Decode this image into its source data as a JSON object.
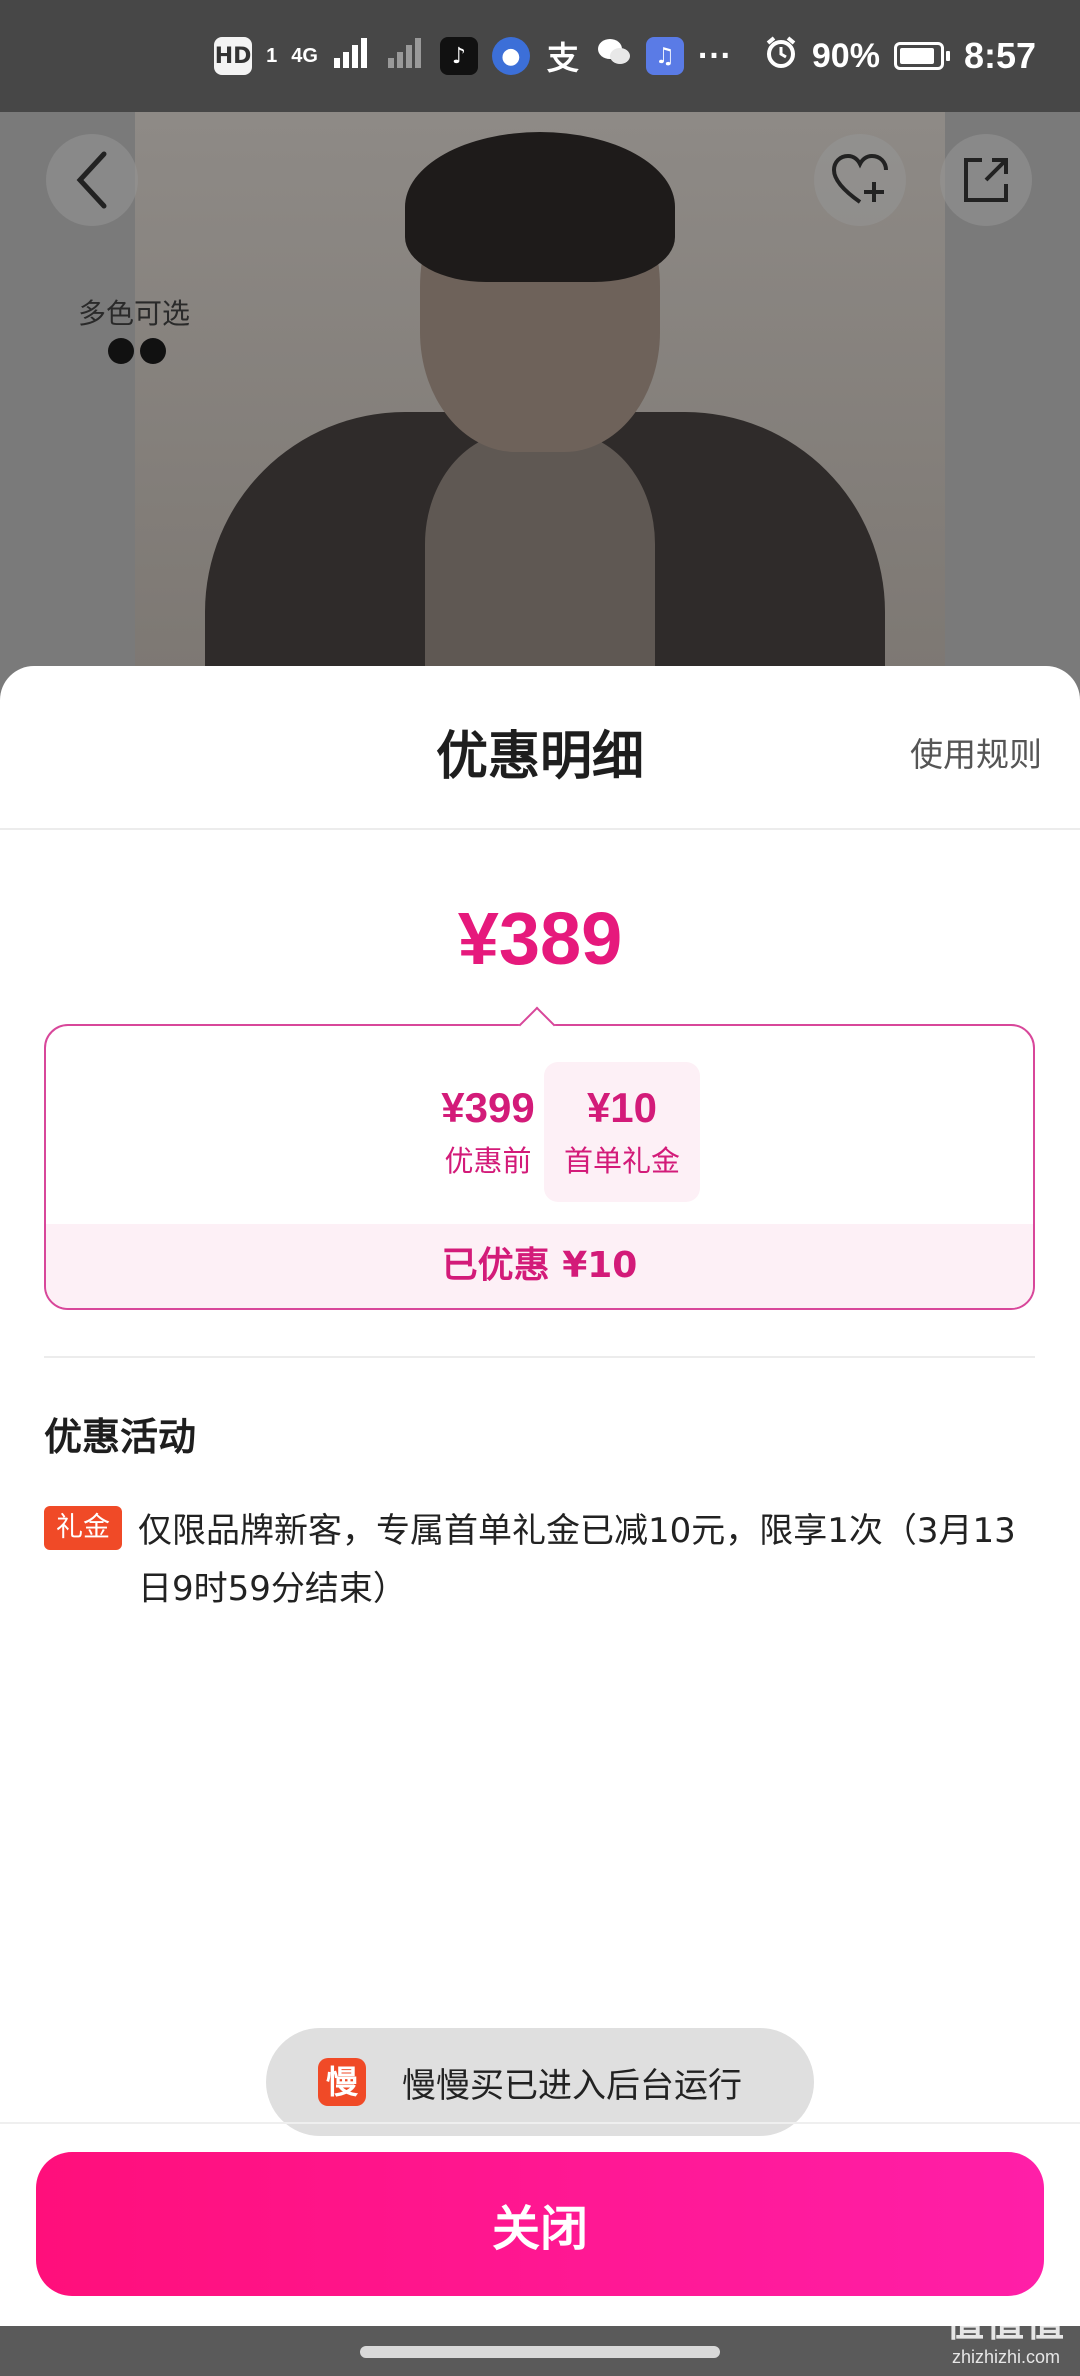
{
  "status_bar": {
    "network_badges": [
      "HD",
      "1",
      "4G"
    ],
    "battery": "90%",
    "time": "8:57",
    "more": "···"
  },
  "product_page": {
    "variant_label": "多色可选"
  },
  "sheet": {
    "title": "优惠明细",
    "rules_link": "使用规则",
    "final_price": "¥389",
    "breakdown": {
      "items": [
        {
          "amount": "¥399",
          "label": "优惠前"
        },
        {
          "amount": "¥10",
          "label": "首单礼金"
        }
      ],
      "operator": "-",
      "saved_total": "已优惠 ¥10"
    },
    "activities_title": "优惠活动",
    "activities": [
      {
        "tag": "礼金",
        "text": "仅限品牌新客，专属首单礼金已减10元，限享1次（3月13日9时59分结束）"
      }
    ],
    "close_label": "关闭"
  },
  "toast": {
    "icon_char": "慢",
    "text": "慢慢买已进入后台运行"
  },
  "watermark": {
    "mark": "值值值",
    "site": "zhizhizhi.com"
  },
  "colors": {
    "accent": "#e6197c",
    "button": "#ff0f7b",
    "tag": "#f04a27"
  }
}
